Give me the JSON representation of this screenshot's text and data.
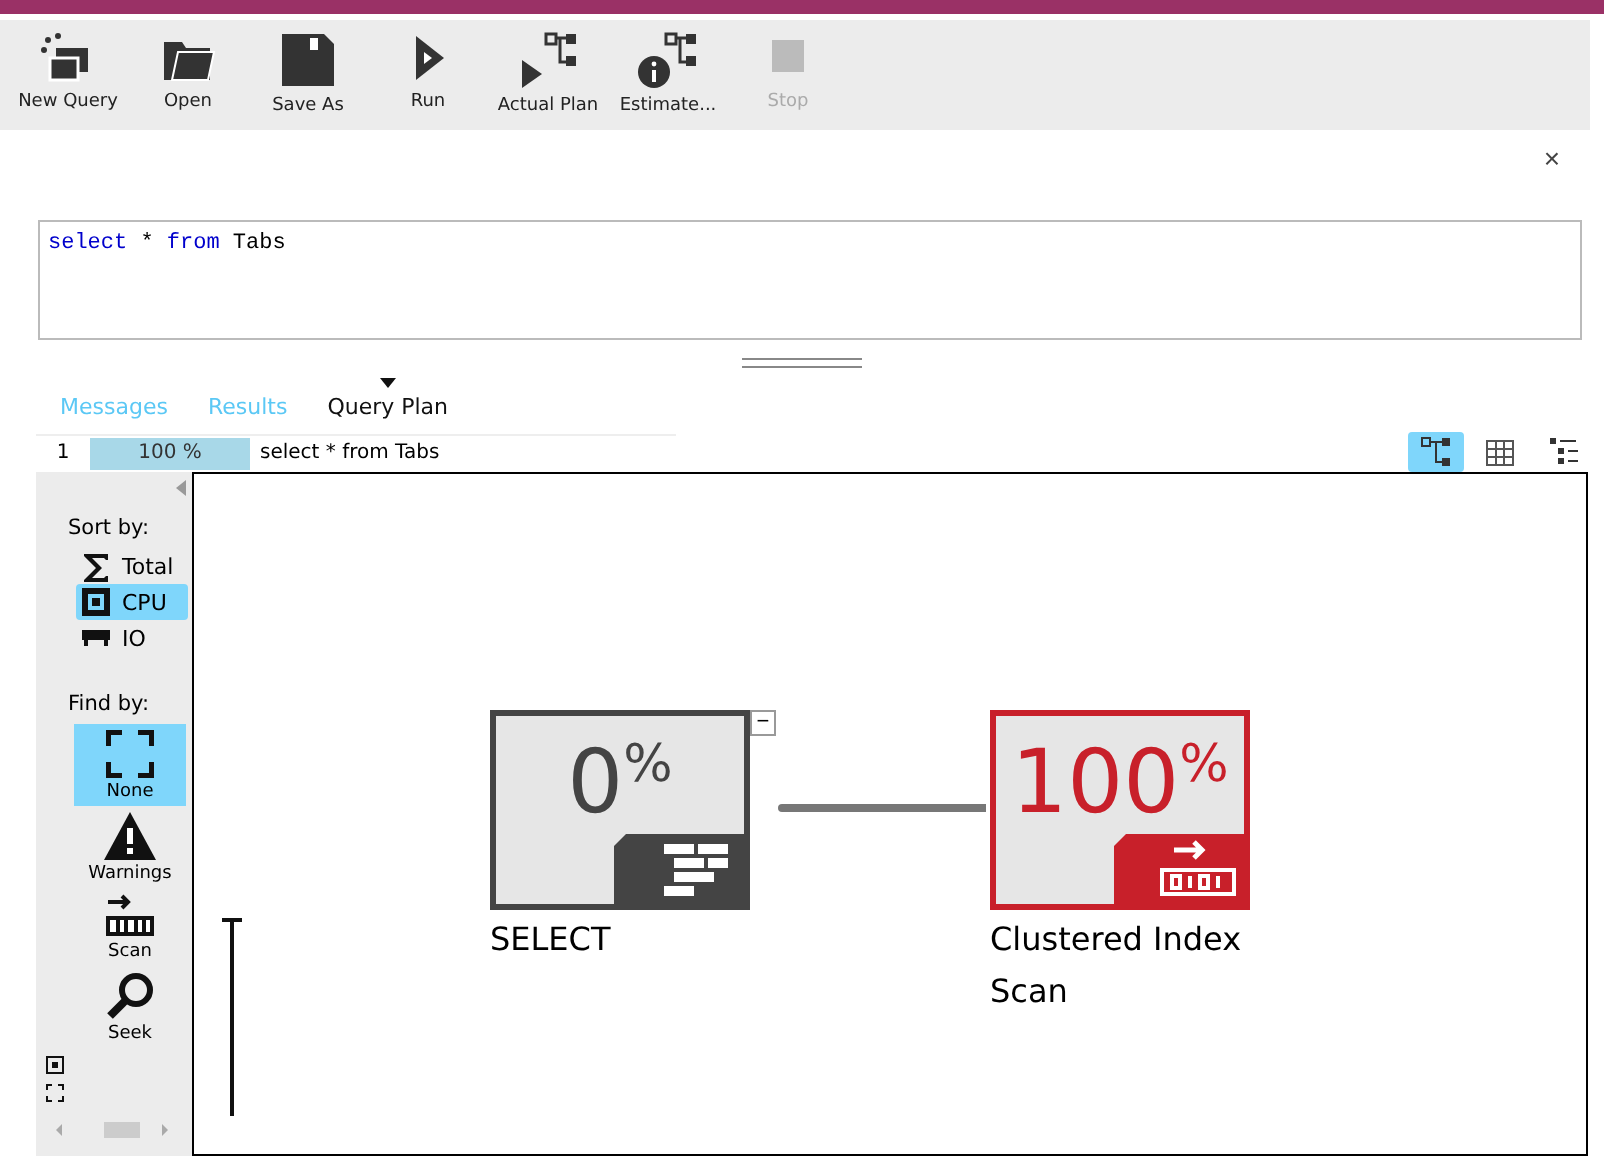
{
  "toolbar": [
    {
      "label": "New Query",
      "kind": "new",
      "disabled": false
    },
    {
      "label": "Open",
      "kind": "open",
      "disabled": false
    },
    {
      "label": "Save As",
      "kind": "save",
      "disabled": false
    },
    {
      "label": "Run",
      "kind": "run",
      "disabled": false
    },
    {
      "label": "Actual Plan",
      "kind": "actual",
      "disabled": false
    },
    {
      "label": "Estimate...",
      "kind": "estimate",
      "disabled": false
    },
    {
      "label": "Stop",
      "kind": "stop",
      "disabled": true
    }
  ],
  "close": "×",
  "editor": {
    "keyword_1": "select",
    "middle": " * ",
    "keyword_2": "from",
    "rest": " Tabs"
  },
  "tabs": [
    {
      "label": "Messages",
      "selected": false
    },
    {
      "label": "Results",
      "selected": false
    },
    {
      "label": "Query Plan",
      "selected": true
    }
  ],
  "statement": {
    "number": "1",
    "percent": "100 %",
    "text": "select * from Tabs"
  },
  "views": [
    {
      "kind": "plan",
      "selected": true
    },
    {
      "kind": "grid",
      "selected": false
    },
    {
      "kind": "list",
      "selected": false
    }
  ],
  "sidebar": {
    "sort_title": "Sort by:",
    "sort": [
      {
        "label": "Total",
        "kind": "sigma",
        "selected": false
      },
      {
        "label": "CPU",
        "kind": "cpu",
        "selected": true
      },
      {
        "label": "IO",
        "kind": "io",
        "selected": false
      }
    ],
    "find_title": "Find by:",
    "find": [
      {
        "label": "None",
        "kind": "none",
        "selected": true
      },
      {
        "label": "Warnings",
        "kind": "warning",
        "selected": false
      },
      {
        "label": "Scan",
        "kind": "scan",
        "selected": false
      },
      {
        "label": "Seek",
        "kind": "seek",
        "selected": false
      }
    ]
  },
  "nodes": [
    {
      "percent": "0",
      "sign": "%",
      "label": "SELECT",
      "kind": "select",
      "costly": false,
      "collapse": "−"
    },
    {
      "percent": "100",
      "sign": "%",
      "label": "Clustered Index Scan",
      "kind": "scan",
      "costly": true
    }
  ]
}
